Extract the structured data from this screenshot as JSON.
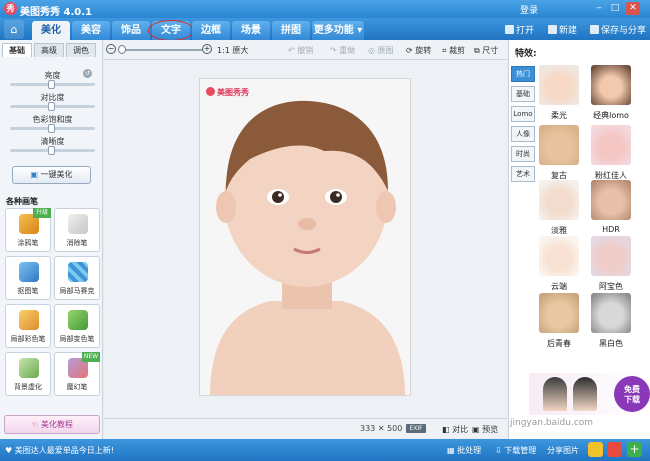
{
  "titlebar": {
    "logo_glyph": "秀",
    "title": "美图秀秀 4.0.1",
    "login": "登录",
    "buttons": [
      "‒",
      "□",
      "✕"
    ]
  },
  "nav": {
    "home_glyph": "⌂",
    "tabs": [
      "美化",
      "美容",
      "饰品",
      "文字",
      "边框",
      "场景",
      "拼图",
      "更多功能 ▾"
    ],
    "active_tab": "美化",
    "circled_tab": "文字",
    "actions": [
      "打开",
      "新建",
      "保存与分享"
    ]
  },
  "left": {
    "subtabs": [
      "基础",
      "高级",
      "调色"
    ],
    "sliders": [
      {
        "label": "亮度",
        "value": 0.5
      },
      {
        "label": "对比度",
        "value": 0.5
      },
      {
        "label": "色彩饱和度",
        "value": 0.5
      },
      {
        "label": "清晰度",
        "value": 0.5
      }
    ],
    "one_click": "一键美化",
    "brush_header": "各种画笔",
    "tools": [
      {
        "label": "涂鸦笔",
        "badge": "升级"
      },
      {
        "label": "消除笔",
        "badge": ""
      },
      {
        "label": "抠图笔",
        "badge": ""
      },
      {
        "label": "局部马赛克",
        "badge": ""
      },
      {
        "label": "局部彩色笔",
        "badge": ""
      },
      {
        "label": "局部变色笔",
        "badge": ""
      },
      {
        "label": "背景虚化",
        "badge": ""
      },
      {
        "label": "魔幻笔",
        "badge": "NEW"
      }
    ],
    "tutorial": "美化教程"
  },
  "toolbar": {
    "ratio": "1:1 原大",
    "undo": "撤销",
    "redo": "重做",
    "original": "原图",
    "rotate": "旋转",
    "crop": "裁剪",
    "size": "尺寸"
  },
  "canvas": {
    "watermark": "美图秀秀",
    "width": "333",
    "times": "✕",
    "height": "500",
    "exif": "EXIF",
    "compare": "对比",
    "preview": "预览"
  },
  "right": {
    "title": "特效:",
    "categories": [
      "热门",
      "基础",
      "Lomo",
      "人像",
      "时尚",
      "艺术"
    ],
    "active_category": "热门",
    "effects": [
      "柔光",
      "经典lomo",
      "复古",
      "粉红佳人",
      "淡雅",
      "HDR",
      "云端",
      "阿宝色",
      "后青春",
      "黑白色"
    ],
    "ad_text": [
      "免费",
      "下载"
    ]
  },
  "status": {
    "text": "美图达人最爱单品今日上新!",
    "batch": "批处理",
    "download": "下载管理",
    "share": "分享图片",
    "site_watermark": "jingyan.baidu.com"
  }
}
